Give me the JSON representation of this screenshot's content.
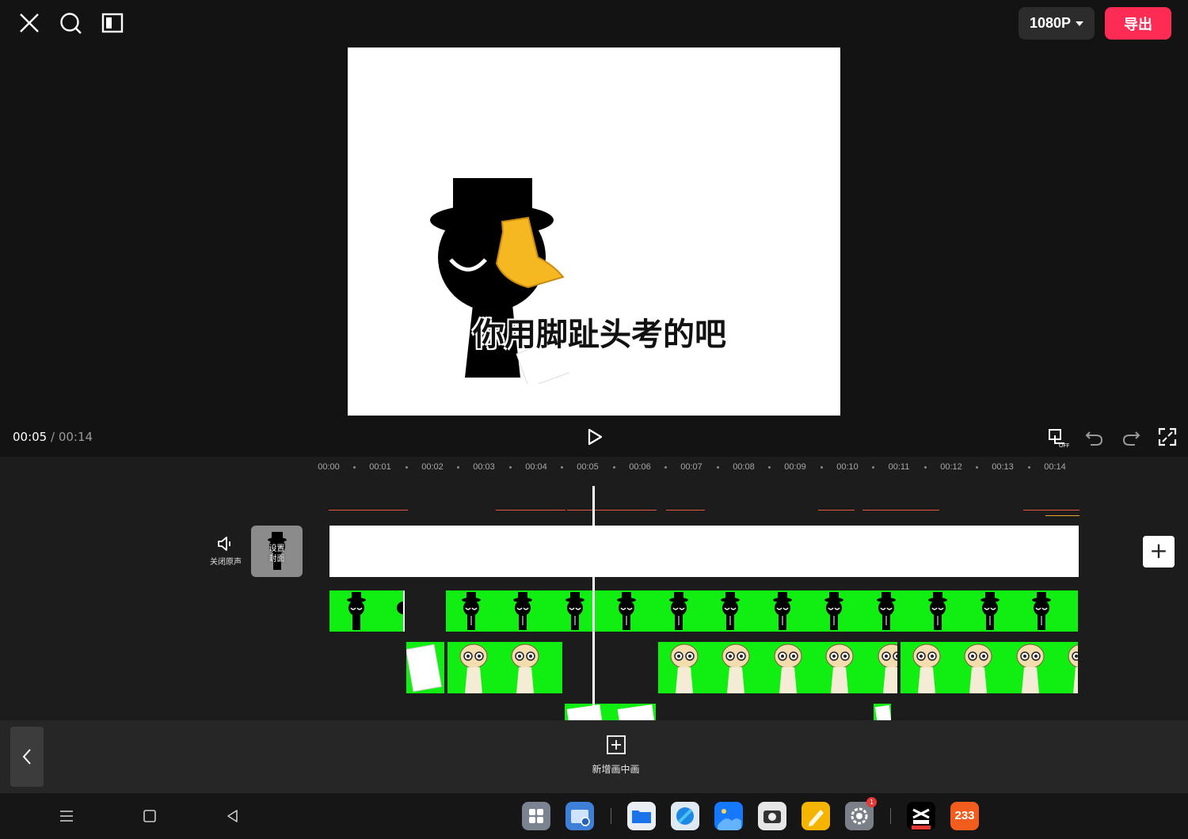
{
  "topbar": {
    "close_icon": "close-icon",
    "search_icon": "search-icon",
    "layout_icon": "layout-icon",
    "resolution": "1080P",
    "export_label": "导出",
    "export_color": "#fe2c55"
  },
  "preview": {
    "subtitle": "你用脚趾头考的吧"
  },
  "playback": {
    "current": "00:05",
    "separator": " / ",
    "total": "00:14"
  },
  "ruler": {
    "labels": [
      "00:00",
      "00:01",
      "00:02",
      "00:03",
      "00:04",
      "00:05",
      "00:06",
      "00:07",
      "00:08",
      "00:09",
      "00:10",
      "00:11",
      "00:12",
      "00:13",
      "00:14"
    ]
  },
  "tracks": {
    "mute_label": "关闭原声",
    "cover_line1": "设置",
    "cover_line2": "封面",
    "add_label": "+"
  },
  "toolbar": {
    "pip_label": "新增画中画"
  },
  "dock": {
    "notification_badge": "1",
    "app_233_label": "233"
  }
}
